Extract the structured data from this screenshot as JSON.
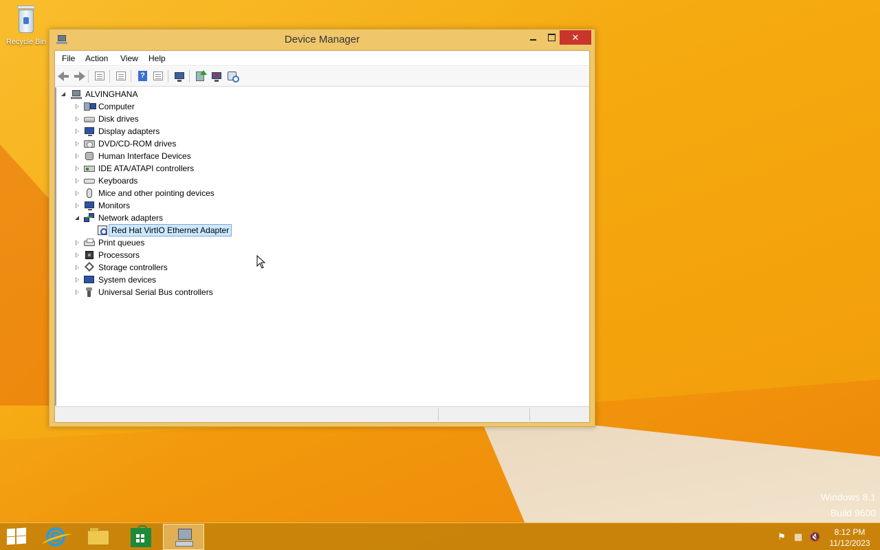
{
  "desktop": {
    "recycle_bin_label": "Recycle Bin",
    "watermark": {
      "line1": "Windows 8.1",
      "line2": "Build 9600"
    }
  },
  "window": {
    "title": "Device Manager",
    "buttons": {
      "minimize": "",
      "maximize": "",
      "close": "✕"
    },
    "menu": [
      "File",
      "Action",
      "View",
      "Help"
    ],
    "toolbar_icons": [
      "back-arrow-icon",
      "forward-arrow-icon",
      "show-hide-console-tree-icon",
      "properties-icon",
      "help-icon",
      "action-pane-icon",
      "scan-hardware-icon",
      "update-driver-icon",
      "uninstall-device-icon",
      "disable-device-icon"
    ],
    "tree": {
      "root": "ALVINGHANA",
      "categories": [
        {
          "label": "Computer",
          "icon": "computer-icon",
          "expanded": false
        },
        {
          "label": "Disk drives",
          "icon": "disk-drive-icon",
          "expanded": false
        },
        {
          "label": "Display adapters",
          "icon": "display-adapter-icon",
          "expanded": false
        },
        {
          "label": "DVD/CD-ROM drives",
          "icon": "dvd-drive-icon",
          "expanded": false
        },
        {
          "label": "Human Interface Devices",
          "icon": "hid-icon",
          "expanded": false
        },
        {
          "label": "IDE ATA/ATAPI controllers",
          "icon": "ide-controller-icon",
          "expanded": false
        },
        {
          "label": "Keyboards",
          "icon": "keyboard-icon",
          "expanded": false
        },
        {
          "label": "Mice and other pointing devices",
          "icon": "mouse-icon",
          "expanded": false
        },
        {
          "label": "Monitors",
          "icon": "monitor-icon",
          "expanded": false
        },
        {
          "label": "Network adapters",
          "icon": "network-adapter-icon",
          "expanded": true,
          "children": [
            {
              "label": "Red Hat VirtIO Ethernet Adapter",
              "icon": "ethernet-adapter-icon",
              "selected": true
            }
          ]
        },
        {
          "label": "Print queues",
          "icon": "printer-icon",
          "expanded": false
        },
        {
          "label": "Processors",
          "icon": "processor-icon",
          "expanded": false
        },
        {
          "label": "Storage controllers",
          "icon": "storage-controller-icon",
          "expanded": false
        },
        {
          "label": "System devices",
          "icon": "system-devices-icon",
          "expanded": false
        },
        {
          "label": "Universal Serial Bus controllers",
          "icon": "usb-icon",
          "expanded": false
        }
      ]
    },
    "statusbar": [
      "",
      "",
      ""
    ]
  },
  "taskbar": {
    "start_icon": "windows-start-icon",
    "pinned": [
      {
        "name": "internet-explorer",
        "icon": "internet-explorer-icon",
        "active": false
      },
      {
        "name": "file-explorer",
        "icon": "file-explorer-icon",
        "active": false
      },
      {
        "name": "store",
        "icon": "store-icon",
        "active": false
      },
      {
        "name": "device-manager",
        "icon": "device-manager-icon",
        "active": true
      }
    ],
    "tray_icons": [
      "action-center-flag-icon",
      "network-icon",
      "volume-muted-icon"
    ],
    "clock": {
      "time": "8:12 PM",
      "date": "11/12/2023"
    }
  },
  "colors": {
    "desktop_bg": "#f5a80e",
    "window_frame": "#f0c66a",
    "close_button": "#c7352b",
    "selection_bg": "#cde8ff",
    "selection_border": "#7aa9dc"
  }
}
